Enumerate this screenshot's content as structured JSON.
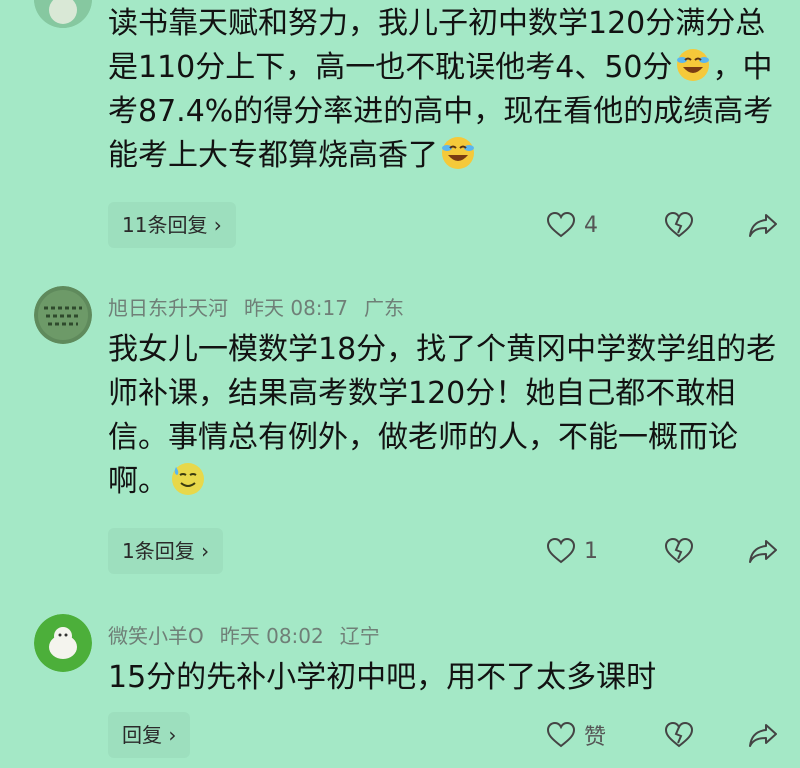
{
  "comments": [
    {
      "avatar": "green-avatar",
      "text_parts": [
        "读书靠天赋和努力，我儿子初中数学120分满分总是110分上下，高一也不耽误他考4、50分",
        "，中考87.4%的得分率进的高中，现在看他的成绩高考能考上大专都算烧高香了"
      ],
      "emojis": [
        "cry-laugh-emoji",
        "cry-laugh-emoji"
      ],
      "reply_label": "11条回复 ›",
      "like_count": "4"
    },
    {
      "username": "旭日东升天河",
      "time": "昨天 08:17",
      "location": "广东",
      "avatar": "calligraphy-avatar",
      "text": "我女儿一模数学18分，找了个黄冈中学数学组的老师补课，结果高考数学120分！她自己都不敢相信。事情总有例外，做老师的人，不能一概而论啊。",
      "emojis": [
        "sweat-smile-emoji"
      ],
      "reply_label": "1条回复 ›",
      "like_count": "1"
    },
    {
      "username": "微笑小羊O",
      "time": "昨天 08:02",
      "location": "辽宁",
      "avatar": "sheep-avatar",
      "text": "15分的先补小学初中吧，用不了太多课时",
      "reply_label": "回复 ›",
      "like_count": "赞"
    }
  ],
  "colors": {
    "background": "#a4e8c6",
    "meta_text": "#6f7f77",
    "reply_chip": "#9ddfbe"
  }
}
